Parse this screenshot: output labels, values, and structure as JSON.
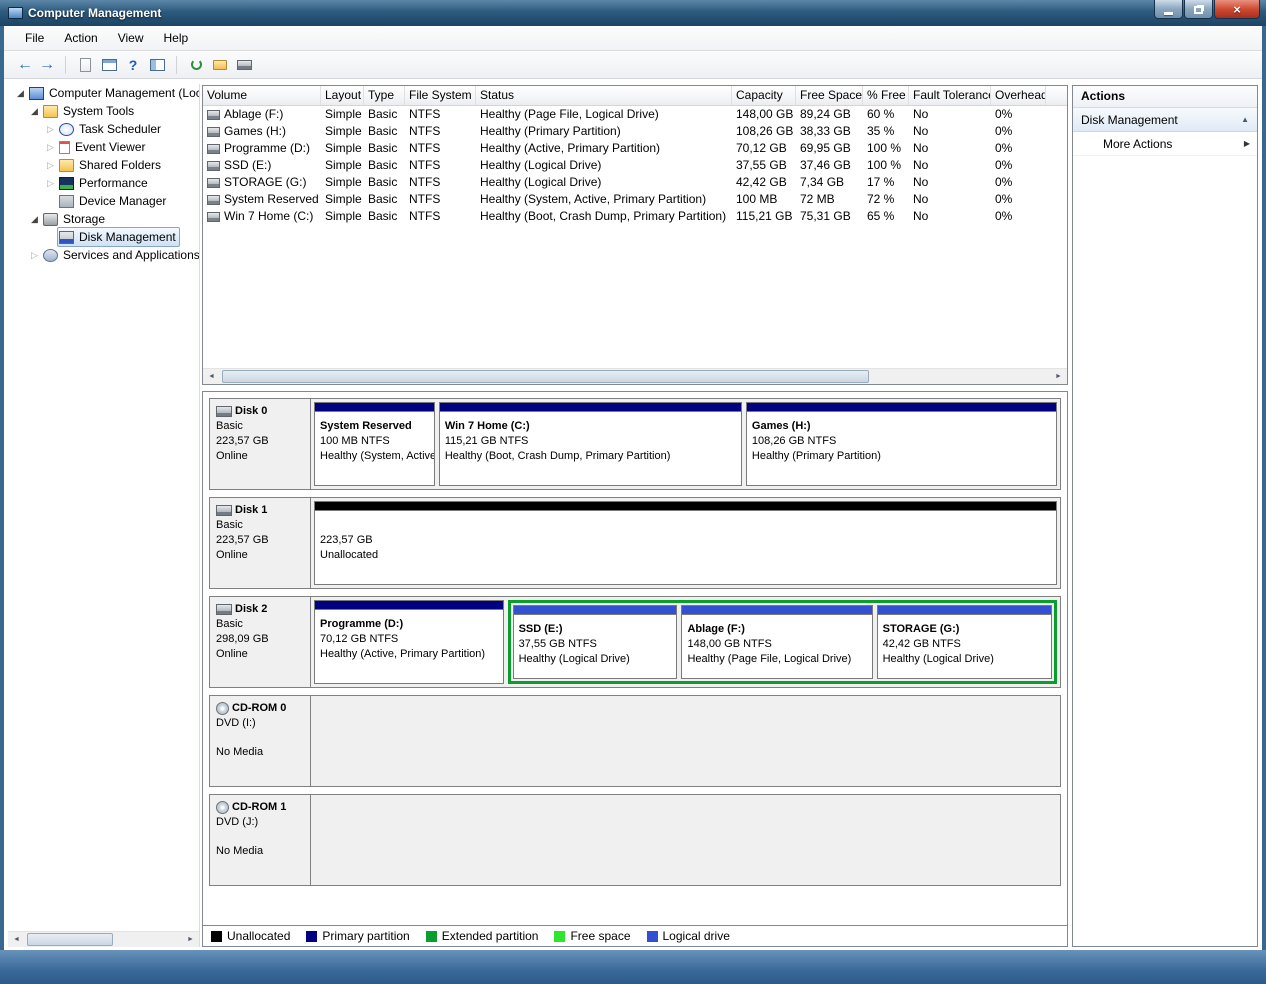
{
  "window": {
    "title": "Computer Management"
  },
  "menubar": {
    "items": [
      "File",
      "Action",
      "View",
      "Help"
    ]
  },
  "icons": {
    "expanded": "◢",
    "collapsed": "▷",
    "back": "←",
    "forward": "→",
    "scroll_left": "◄",
    "scroll_right": "►",
    "collapse_chevron": "▲",
    "more_arrow": "▶",
    "help": "?",
    "close": "×"
  },
  "tree": {
    "items": [
      "Computer Management (Local)",
      "System Tools",
      "Task Scheduler",
      "Event Viewer",
      "Shared Folders",
      "Performance",
      "Device Manager",
      "Storage",
      "Disk Management",
      "Services and Applications"
    ]
  },
  "volume_list": {
    "columns": [
      "Volume",
      "Layout",
      "Type",
      "File System",
      "Status",
      "Capacity",
      "Free Space",
      "% Free",
      "Fault Tolerance",
      "Overhead"
    ],
    "rows": [
      {
        "cells": [
          "Ablage (F:)",
          "Simple",
          "Basic",
          "NTFS",
          "Healthy (Page File, Logical Drive)",
          "148,00 GB",
          "89,24 GB",
          "60 %",
          "No",
          "0%"
        ]
      },
      {
        "cells": [
          "Games (H:)",
          "Simple",
          "Basic",
          "NTFS",
          "Healthy (Primary Partition)",
          "108,26 GB",
          "38,33 GB",
          "35 %",
          "No",
          "0%"
        ]
      },
      {
        "cells": [
          "Programme (D:)",
          "Simple",
          "Basic",
          "NTFS",
          "Healthy (Active, Primary Partition)",
          "70,12 GB",
          "69,95 GB",
          "100 %",
          "No",
          "0%"
        ]
      },
      {
        "cells": [
          "SSD (E:)",
          "Simple",
          "Basic",
          "NTFS",
          "Healthy (Logical Drive)",
          "37,55 GB",
          "37,46 GB",
          "100 %",
          "No",
          "0%"
        ]
      },
      {
        "cells": [
          "STORAGE (G:)",
          "Simple",
          "Basic",
          "NTFS",
          "Healthy (Logical Drive)",
          "42,42 GB",
          "7,34 GB",
          "17 %",
          "No",
          "0%"
        ]
      },
      {
        "cells": [
          "System Reserved",
          "Simple",
          "Basic",
          "NTFS",
          "Healthy (System, Active, Primary Partition)",
          "100 MB",
          "72 MB",
          "72 %",
          "No",
          "0%"
        ]
      },
      {
        "cells": [
          "Win 7 Home (C:)",
          "Simple",
          "Basic",
          "NTFS",
          "Healthy (Boot, Crash Dump, Primary Partition)",
          "115,21 GB",
          "75,31 GB",
          "65 %",
          "No",
          "0%"
        ]
      }
    ]
  },
  "disks": [
    {
      "name": "Disk 0",
      "kind": "Basic",
      "size": "223,57 GB",
      "state": "Online",
      "partitions": [
        {
          "title": "System Reserved",
          "size_line": "100 MB NTFS",
          "status_line": "Healthy (System, Active, Primary Partition)",
          "color": "#000080"
        },
        {
          "title": "Win 7 Home (C:)",
          "size_line": "115,21 GB NTFS",
          "status_line": "Healthy (Boot, Crash Dump, Primary Partition)",
          "color": "#000080"
        },
        {
          "title": "Games (H:)",
          "size_line": "108,26 GB NTFS",
          "status_line": "Healthy (Primary Partition)",
          "color": "#000080"
        }
      ]
    },
    {
      "name": "Disk 1",
      "kind": "Basic",
      "size": "223,57 GB",
      "state": "Online",
      "partitions": [
        {
          "title": "",
          "size_line": "223,57 GB",
          "status_line": "Unallocated",
          "color": "#000000"
        }
      ]
    },
    {
      "name": "Disk 2",
      "kind": "Basic",
      "size": "298,09 GB",
      "state": "Online",
      "primary": [
        {
          "title": "Programme (D:)",
          "size_line": "70,12 GB NTFS",
          "status_line": "Healthy (Active, Primary Partition)",
          "color": "#000080"
        }
      ],
      "extended": [
        {
          "title": "SSD (E:)",
          "size_line": "37,55 GB NTFS",
          "status_line": "Healthy (Logical Drive)",
          "color": "#3350d2"
        },
        {
          "title": "Ablage (F:)",
          "size_line": "148,00 GB NTFS",
          "status_line": "Healthy (Page File, Logical Drive)",
          "color": "#3350d2"
        },
        {
          "title": "STORAGE (G:)",
          "size_line": "42,42 GB NTFS",
          "status_line": "Healthy (Logical Drive)",
          "color": "#3350d2"
        }
      ]
    },
    {
      "name": "CD-ROM 0",
      "kind": "DVD (I:)",
      "state": "No Media"
    },
    {
      "name": "CD-ROM 1",
      "kind": "DVD (J:)",
      "state": "No Media"
    }
  ],
  "legend": {
    "items": [
      {
        "label": "Unallocated",
        "color": "#000000"
      },
      {
        "label": "Primary partition",
        "color": "#000080"
      },
      {
        "label": "Extended partition",
        "color": "#0a9e2d"
      },
      {
        "label": "Free space",
        "color": "#2ee62e"
      },
      {
        "label": "Logical drive",
        "color": "#3350d2"
      }
    ]
  },
  "actions": {
    "title": "Actions",
    "section": "Disk Management",
    "more": "More Actions"
  }
}
